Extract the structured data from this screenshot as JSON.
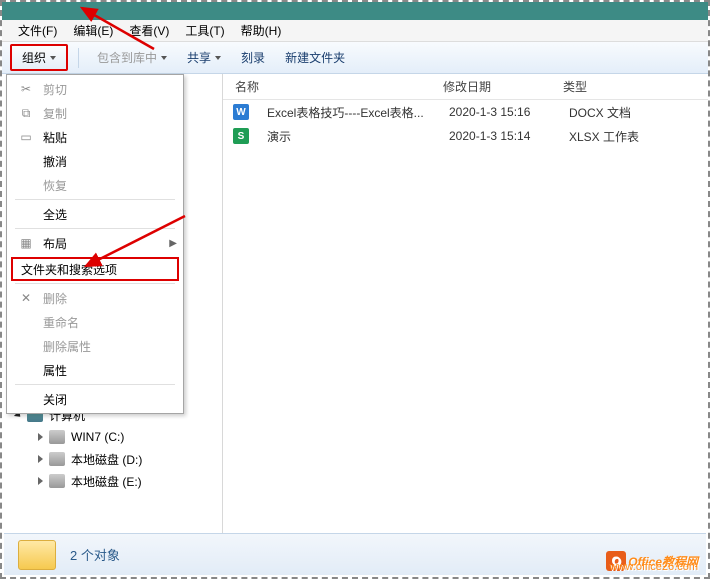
{
  "menubar": {
    "items": [
      "文件(F)",
      "编辑(E)",
      "查看(V)",
      "工具(T)",
      "帮助(H)"
    ]
  },
  "toolbar": {
    "organize": "组织",
    "include": "包含到库中",
    "share": "共享",
    "burn": "刻录",
    "newfolder": "新建文件夹"
  },
  "dropdown": {
    "cut": "剪切",
    "copy": "复制",
    "paste": "粘贴",
    "undo": "撤消",
    "redo": "恢复",
    "selectall": "全选",
    "layout": "布局",
    "folderoptions": "文件夹和搜索选项",
    "delete": "删除",
    "rename": "重命名",
    "removeprops": "删除属性",
    "properties": "属性",
    "close": "关闭"
  },
  "tree": {
    "computer": "计算机",
    "drives": [
      {
        "label": "WIN7 (C:)"
      },
      {
        "label": "本地磁盘 (D:)"
      },
      {
        "label": "本地磁盘 (E:)"
      }
    ]
  },
  "list": {
    "headers": {
      "name": "名称",
      "date": "修改日期",
      "type": "类型"
    },
    "rows": [
      {
        "icon": "docx",
        "iconLetter": "W",
        "name": "Excel表格技巧----Excel表格...",
        "date": "2020-1-3 15:16",
        "type": "DOCX 文档"
      },
      {
        "icon": "xlsx",
        "iconLetter": "S",
        "name": "演示",
        "date": "2020-1-3 15:14",
        "type": "XLSX 工作表"
      }
    ]
  },
  "status": {
    "text": "2 个对象"
  },
  "watermark": {
    "brand": "Office教程网",
    "url": "www.office26.com"
  }
}
